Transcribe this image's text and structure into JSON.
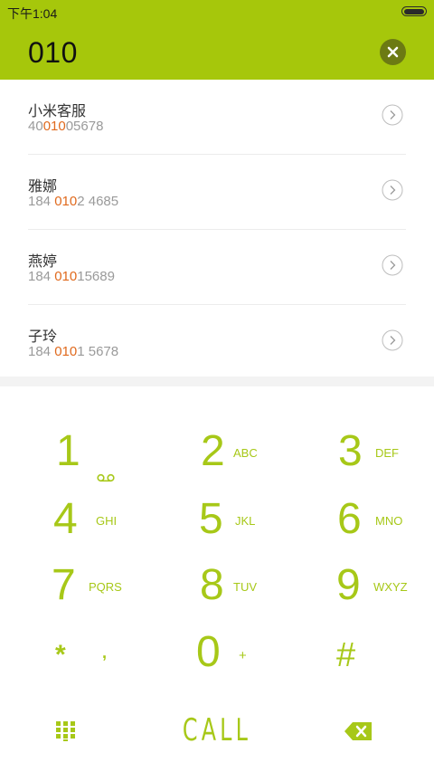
{
  "status_bar": {
    "time": "下午1:04"
  },
  "dialer": {
    "input_value": "010"
  },
  "results": [
    {
      "name": "小米客服",
      "phone_before": "40",
      "phone_match": "010",
      "phone_after": "05678"
    },
    {
      "name": "雅娜",
      "phone_before": "184 ",
      "phone_match": "010",
      "phone_after": "2 4685"
    },
    {
      "name": "燕婷",
      "phone_before": "184 ",
      "phone_match": "010",
      "phone_after": "15689"
    },
    {
      "name": "子玲",
      "phone_before": "184 ",
      "phone_match": "010",
      "phone_after": "1 5678"
    }
  ],
  "keypad": {
    "keys": [
      {
        "digit": "1",
        "letters": ""
      },
      {
        "digit": "2",
        "letters": "ABC"
      },
      {
        "digit": "3",
        "letters": "DEF"
      },
      {
        "digit": "4",
        "letters": "GHI"
      },
      {
        "digit": "5",
        "letters": "JKL"
      },
      {
        "digit": "6",
        "letters": "MNO"
      },
      {
        "digit": "7",
        "letters": "PQRS"
      },
      {
        "digit": "8",
        "letters": "TUV"
      },
      {
        "digit": "9",
        "letters": "WXYZ"
      },
      {
        "digit": "*",
        "letters": ","
      },
      {
        "digit": "0",
        "letters": "+"
      },
      {
        "digit": "#",
        "letters": ""
      }
    ],
    "call_label": "CALL",
    "icons": {
      "voicemail": "voicemail-icon",
      "dialpad": "dialpad-icon",
      "backspace": "backspace-icon"
    }
  },
  "colors": {
    "accent": "#a6c70b",
    "highlight": "#e06a1e",
    "clear_button": "#6c7a13"
  }
}
